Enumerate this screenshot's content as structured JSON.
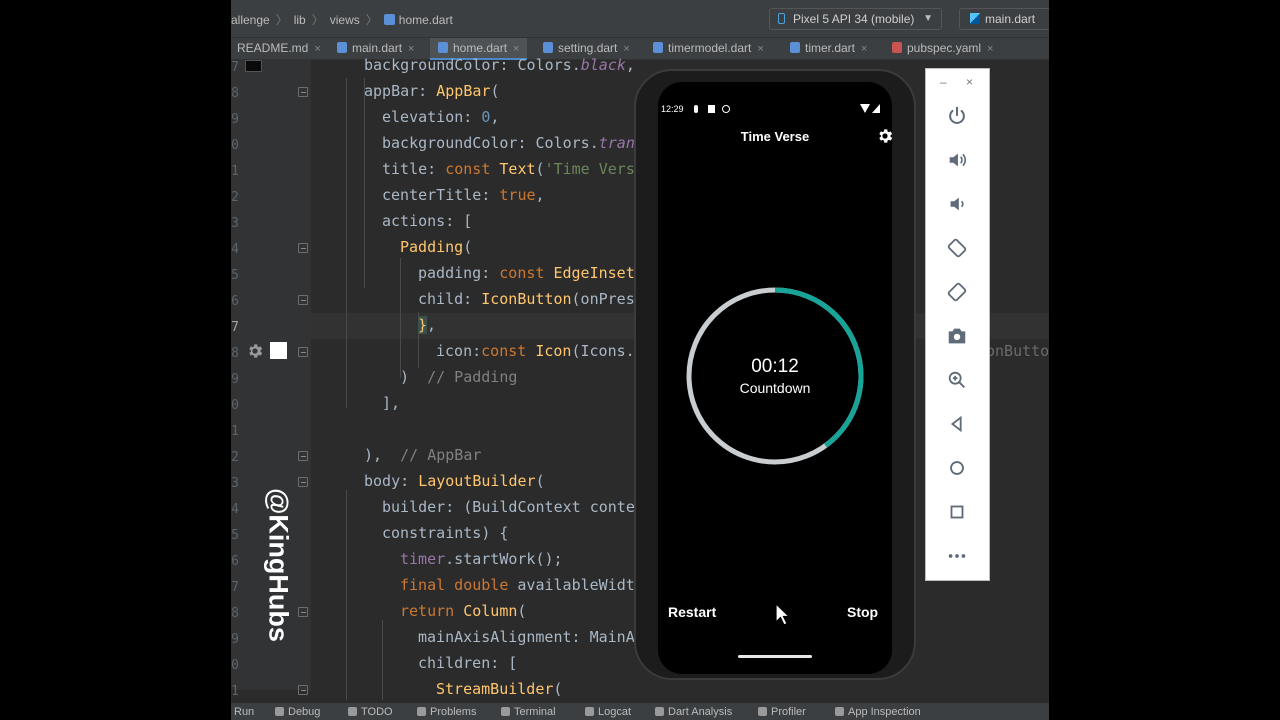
{
  "ide": {
    "breadcrumb": [
      "allenge",
      "lib",
      "views",
      "home.dart"
    ],
    "device_selector": "Pixel 5 API 34 (mobile)",
    "run_config": "main.dart",
    "tabs": [
      {
        "label": "README.md",
        "active": false
      },
      {
        "label": "main.dart",
        "active": false
      },
      {
        "label": "home.dart",
        "active": true
      },
      {
        "label": "setting.dart",
        "active": false
      },
      {
        "label": "timermodel.dart",
        "active": false
      },
      {
        "label": "timer.dart",
        "active": false
      },
      {
        "label": "pubspec.yaml",
        "active": false
      }
    ],
    "line_numbers": [
      "7",
      "8",
      "9",
      "0",
      "1",
      "2",
      "3",
      "4",
      "5",
      "6",
      "7",
      "8",
      "9",
      "0",
      "1",
      "2",
      "3",
      "4",
      "5",
      "6",
      "7",
      "8",
      "9",
      "0",
      "1"
    ],
    "code_overflow_text": "onButto",
    "bottom_bar": [
      "Run",
      "Debug",
      "TODO",
      "Problems",
      "Terminal",
      "Logcat",
      "Dart Analysis",
      "Profiler",
      "App Inspection"
    ]
  },
  "watermark": "@KingHubs",
  "phone": {
    "status_time": "12:29",
    "app_title": "Time Verse",
    "timer_value": "00:12",
    "timer_label": "Countdown",
    "progress_fraction": 0.4,
    "restart_label": "Restart",
    "stop_label": "Stop",
    "colors": {
      "progress": "#17a398",
      "track": "#c9cdd0",
      "background": "#000000"
    }
  },
  "emulator_panel": {
    "window_controls": [
      "–",
      "×"
    ],
    "icons": [
      "power-icon",
      "volume-up-icon",
      "volume-down-icon",
      "rotate-left-icon",
      "rotate-right-icon",
      "camera-icon",
      "zoom-icon",
      "back-icon",
      "home-icon",
      "overview-icon",
      "more-icon"
    ]
  }
}
